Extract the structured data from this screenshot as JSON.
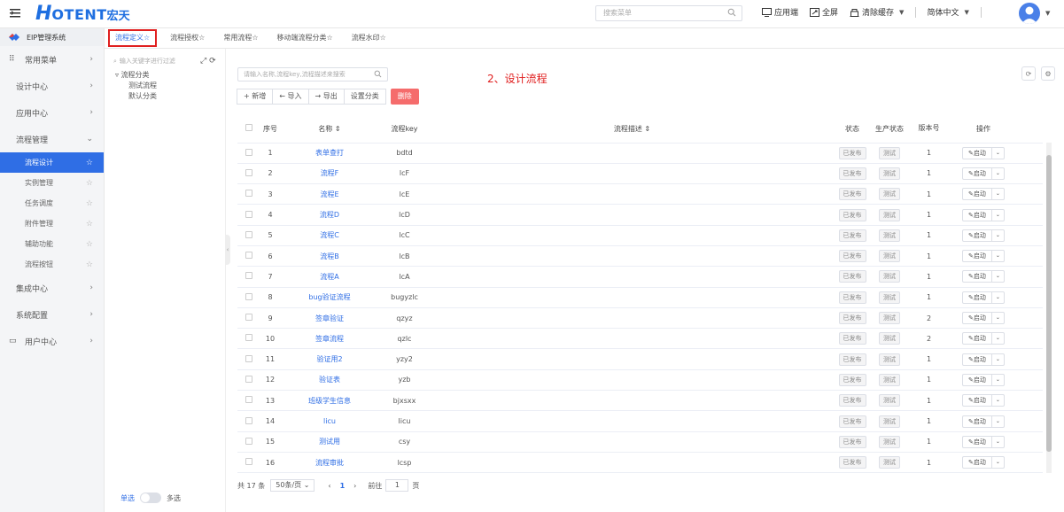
{
  "header": {
    "logo_mark": "H",
    "logo_text": "OTENT",
    "logo_cn": "宏天",
    "search_placeholder": "搜索菜单",
    "links": [
      "应用端",
      "全屏",
      "清除缓存",
      "简体中文"
    ]
  },
  "sidebar": {
    "brand": "EIP管理系统",
    "items": [
      {
        "label": "常用菜单",
        "icon": "grid-icon"
      },
      {
        "label": "设计中心"
      },
      {
        "label": "应用中心"
      },
      {
        "label": "流程管理",
        "expanded": true
      }
    ],
    "sub_items": [
      "流程设计",
      "实例管理",
      "任务调度",
      "附件管理",
      "辅助功能",
      "流程按钮"
    ],
    "items_after": [
      {
        "label": "集成中心"
      },
      {
        "label": "系统配置"
      },
      {
        "label": "用户中心",
        "icon": "monitor-icon"
      }
    ]
  },
  "tabs": [
    "流程定义☆",
    "流程授权☆",
    "常用流程☆",
    "移动端流程分类☆",
    "流程水印☆"
  ],
  "tree": {
    "search_placeholder": "输入关键字进行过滤",
    "root": "流程分类",
    "children": [
      "测试流程",
      "默认分类"
    ],
    "footer_single": "单选",
    "footer_multi": "多选"
  },
  "main": {
    "search_placeholder": "请输入名称,流程key,流程描述来搜索",
    "annotation": "2、设计流程",
    "buttons": [
      "+ 新增",
      "← 导入",
      "→ 导出",
      "设置分类",
      "删除"
    ]
  },
  "table": {
    "headers": [
      "序号",
      "名称 ⇕",
      "流程key",
      "流程描述 ⇕",
      "状态",
      "生产状态",
      "版本号",
      "操作"
    ],
    "rows": [
      {
        "no": "1",
        "name": "表单查打",
        "key": "bdtd",
        "status": "已发布",
        "prod": "测试",
        "ver": "1"
      },
      {
        "no": "2",
        "name": "流程F",
        "key": "lcF",
        "status": "已发布",
        "prod": "测试",
        "ver": "1"
      },
      {
        "no": "3",
        "name": "流程E",
        "key": "lcE",
        "status": "已发布",
        "prod": "测试",
        "ver": "1"
      },
      {
        "no": "4",
        "name": "流程D",
        "key": "lcD",
        "status": "已发布",
        "prod": "测试",
        "ver": "1"
      },
      {
        "no": "5",
        "name": "流程C",
        "key": "lcC",
        "status": "已发布",
        "prod": "测试",
        "ver": "1"
      },
      {
        "no": "6",
        "name": "流程B",
        "key": "lcB",
        "status": "已发布",
        "prod": "测试",
        "ver": "1"
      },
      {
        "no": "7",
        "name": "流程A",
        "key": "lcA",
        "status": "已发布",
        "prod": "测试",
        "ver": "1"
      },
      {
        "no": "8",
        "name": "bug验证流程",
        "key": "bugyzlc",
        "status": "已发布",
        "prod": "测试",
        "ver": "1"
      },
      {
        "no": "9",
        "name": "签章验证",
        "key": "qzyz",
        "status": "已发布",
        "prod": "测试",
        "ver": "2"
      },
      {
        "no": "10",
        "name": "签章流程",
        "key": "qzlc",
        "status": "已发布",
        "prod": "测试",
        "ver": "2"
      },
      {
        "no": "11",
        "name": "验证用2",
        "key": "yzy2",
        "status": "已发布",
        "prod": "测试",
        "ver": "1"
      },
      {
        "no": "12",
        "name": "验证表",
        "key": "yzb",
        "status": "已发布",
        "prod": "测试",
        "ver": "1"
      },
      {
        "no": "13",
        "name": "班级学生信息",
        "key": "bjxsxx",
        "status": "已发布",
        "prod": "测试",
        "ver": "1"
      },
      {
        "no": "14",
        "name": "licu",
        "key": "licu",
        "status": "已发布",
        "prod": "测试",
        "ver": "1"
      },
      {
        "no": "15",
        "name": "测试用",
        "key": "csy",
        "status": "已发布",
        "prod": "测试",
        "ver": "1"
      },
      {
        "no": "16",
        "name": "流程审批",
        "key": "lcsp",
        "status": "已发布",
        "prod": "测试",
        "ver": "1"
      }
    ],
    "op_label": "✎启动"
  },
  "pager": {
    "total": "共 17 条",
    "page_size": "50条/页",
    "current": "1",
    "goto_label": "前往",
    "goto_value": "1",
    "page_unit": "页"
  }
}
